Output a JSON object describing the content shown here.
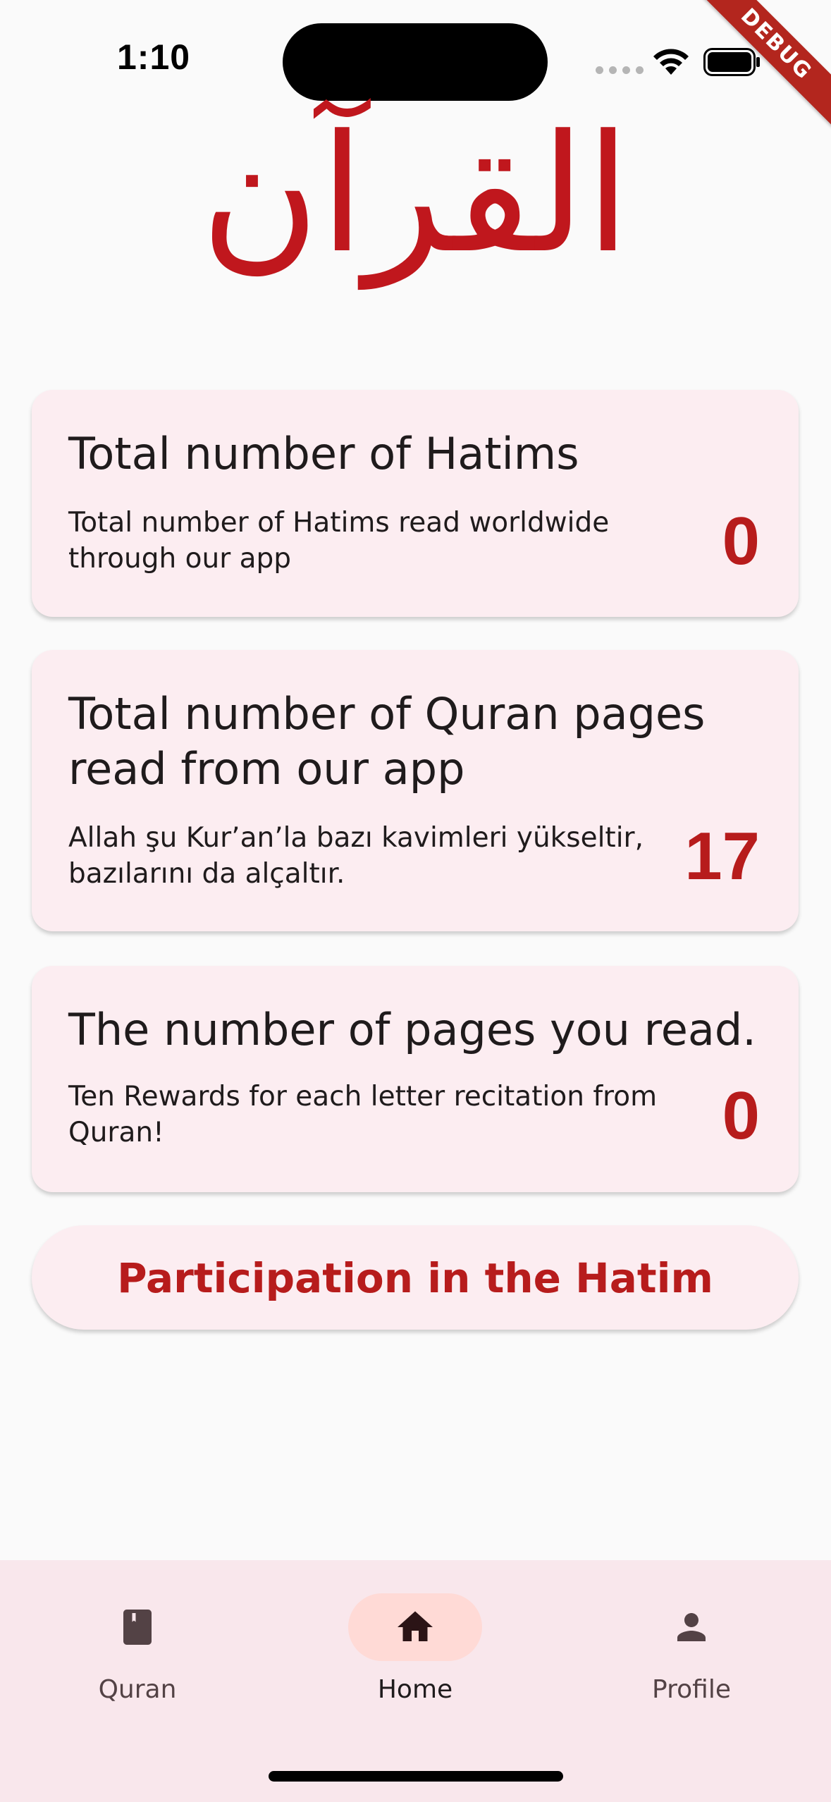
{
  "status_bar": {
    "time": "1:10"
  },
  "debug_banner": "DEBUG",
  "title": "القرآن",
  "cards": {
    "hatims": {
      "title": "Total number of Hatims",
      "description": "Total number of Hatims read worldwide through our app",
      "value": "0"
    },
    "quran_pages": {
      "title": "Total number of Quran pages read from our app",
      "description": "Allah şu Kur’an’la bazı kavimleri yükseltir, bazılarını da alçaltır.",
      "value": "17"
    },
    "your_pages": {
      "title": "The number of pages you read.",
      "description": "Ten Rewards for each letter recitation from Quran!",
      "value": "0"
    }
  },
  "participate_button": "Participation in the Hatim",
  "bottom_nav": {
    "items": [
      {
        "label": "Quran",
        "icon": "book-icon",
        "active": false
      },
      {
        "label": "Home",
        "icon": "home-icon",
        "active": true
      },
      {
        "label": "Profile",
        "icon": "person-icon",
        "active": false
      }
    ]
  },
  "colors": {
    "accent": "#b71c1c",
    "card_background": "#fcedf1",
    "nav_background": "#f9e7ec",
    "active_pill": "#ffdad6"
  }
}
